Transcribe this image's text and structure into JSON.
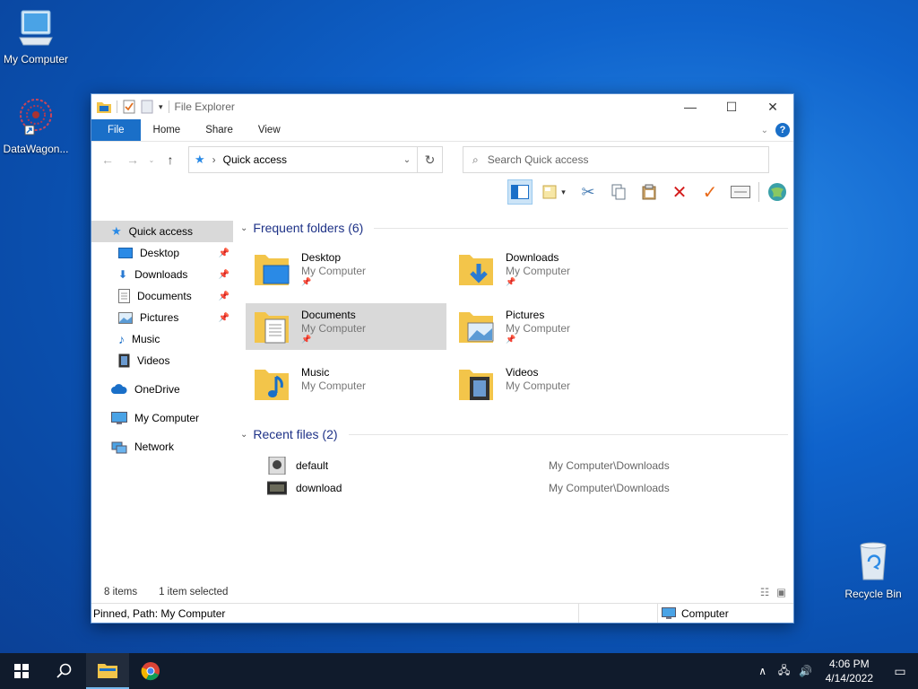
{
  "desktop": {
    "icons": [
      {
        "label": "My Computer"
      },
      {
        "label": "DataWagon..."
      },
      {
        "label": "Recycle Bin"
      }
    ]
  },
  "window": {
    "title": "File Explorer",
    "controls": {
      "minimize": "—",
      "maximize": "☐",
      "close": "✕"
    },
    "tabs": {
      "file": "File",
      "home": "Home",
      "share": "Share",
      "view": "View"
    },
    "help": "?",
    "address": {
      "current": "Quick access"
    },
    "search": {
      "placeholder": "Search Quick access"
    },
    "sidebar": {
      "quick_access": "Quick access",
      "desktop": "Desktop",
      "downloads": "Downloads",
      "documents": "Documents",
      "pictures": "Pictures",
      "music": "Music",
      "videos": "Videos",
      "onedrive": "OneDrive",
      "my_computer": "My Computer",
      "network": "Network"
    },
    "frequent": {
      "header": "Frequent folders (6)",
      "items": [
        {
          "name": "Desktop",
          "location": "My Computer",
          "pinned": true
        },
        {
          "name": "Downloads",
          "location": "My Computer",
          "pinned": true
        },
        {
          "name": "Documents",
          "location": "My Computer",
          "pinned": true
        },
        {
          "name": "Pictures",
          "location": "My Computer",
          "pinned": true
        },
        {
          "name": "Music",
          "location": "My Computer",
          "pinned": false
        },
        {
          "name": "Videos",
          "location": "My Computer",
          "pinned": false
        }
      ]
    },
    "recent": {
      "header": "Recent files (2)",
      "items": [
        {
          "name": "default",
          "path": "My Computer\\Downloads"
        },
        {
          "name": "download",
          "path": "My Computer\\Downloads"
        }
      ]
    },
    "status": {
      "count": "8 items",
      "selected": "1 item selected"
    },
    "details": {
      "left": "Pinned, Path: My Computer",
      "right": "Computer"
    }
  },
  "taskbar": {
    "time": "4:06 PM",
    "date": "4/14/2022"
  },
  "colors": {
    "accent": "#1a6fc8",
    "folder": "#f3c54a",
    "taskbar": "#101b2c"
  }
}
